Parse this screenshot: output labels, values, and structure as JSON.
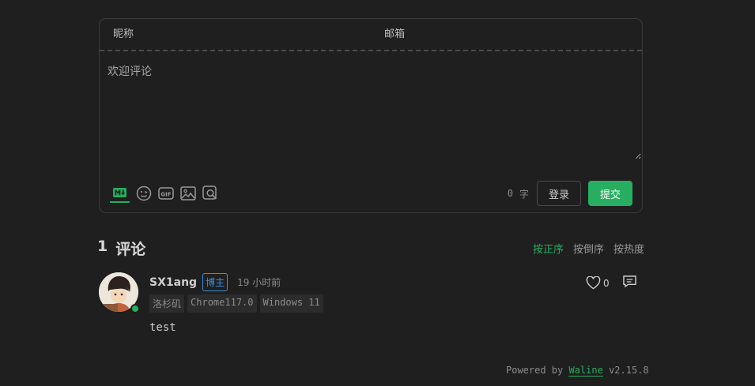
{
  "form": {
    "nick_placeholder": "昵称",
    "email_placeholder": "邮箱",
    "editor_placeholder": "欢迎评论",
    "word_count": "0",
    "word_unit": "字",
    "login_label": "登录",
    "submit_label": "提交",
    "tools": [
      "markdown-icon",
      "emoji-icon",
      "gif-icon",
      "image-icon",
      "preview-icon"
    ]
  },
  "comments": {
    "count": "1",
    "count_label": "评论",
    "sort": {
      "asc": "按正序",
      "desc": "按倒序",
      "hot": "按热度"
    }
  },
  "comment": {
    "nick": "SX1ang",
    "badge": "博主",
    "time": "19 小时前",
    "tags": [
      "洛杉矶",
      "Chrome117.0",
      "Windows 11"
    ],
    "content": "test",
    "likes": "0"
  },
  "footer": {
    "powered_prefix": "Powered by",
    "brand": "Waline",
    "version": "v2.15.8"
  },
  "colors": {
    "accent": "#27ae60",
    "badge": "#3d8fe0",
    "background": "#1f1f1f"
  }
}
